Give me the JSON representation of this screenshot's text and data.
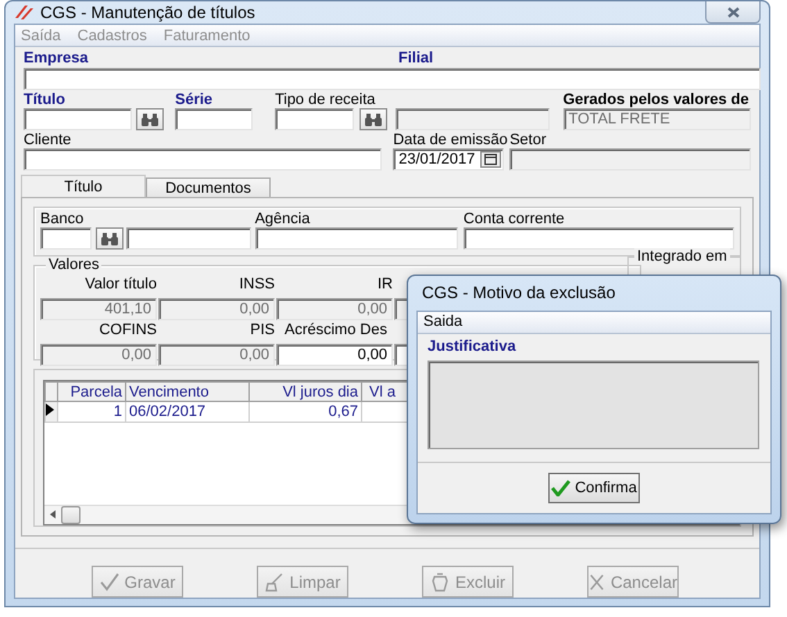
{
  "window": {
    "title": "CGS - Manutenção de títulos"
  },
  "menu": [
    {
      "label": "Saída",
      "disabled": true
    },
    {
      "label": "Cadastros",
      "disabled": true
    },
    {
      "label": "Faturamento",
      "disabled": true
    }
  ],
  "header": {
    "empresa_label": "Empresa",
    "filial_label": "Filial",
    "titulo_label": "Título",
    "serie_label": "Série",
    "tipo_receita_label": "Tipo de receita",
    "gerados_label": "Gerados pelos valores de",
    "gerados_value": "TOTAL FRETE",
    "cliente_label": "Cliente",
    "data_emissao_label": "Data de emissão",
    "data_emissao_value": "23/01/2017",
    "setor_label": "Setor"
  },
  "tabs": [
    {
      "label": "Título",
      "selected": true
    },
    {
      "label": "Documentos",
      "selected": false
    }
  ],
  "banco": {
    "banco_label": "Banco",
    "agencia_label": "Agência",
    "conta_label": "Conta corrente"
  },
  "valores": {
    "title": "Valores",
    "rows": [
      [
        {
          "label": "Valor título",
          "value": "401,10",
          "disabled": true
        },
        {
          "label": "INSS",
          "value": "0,00",
          "disabled": true
        },
        {
          "label": "IR",
          "value": "0,00",
          "disabled": true
        }
      ],
      [
        {
          "label": "COFINS",
          "value": "0,00",
          "disabled": true
        },
        {
          "label": "PIS",
          "value": "0,00",
          "disabled": true
        },
        {
          "label": "Acréscimo",
          "value": "0,00",
          "disabled": false
        }
      ]
    ],
    "cut_label": "Des"
  },
  "integrado": {
    "title": "Integrado em"
  },
  "grid": {
    "columns": [
      "Parcela",
      "Vencimento",
      "Vl juros dia",
      "Vl a"
    ],
    "rows": [
      {
        "cells": [
          "1",
          "06/02/2017",
          "0,67"
        ],
        "selected": true
      }
    ]
  },
  "buttons": [
    {
      "label": "Gravar",
      "kind": "save",
      "disabled": true
    },
    {
      "label": "Limpar",
      "kind": "clear",
      "disabled": true
    },
    {
      "label": "Excluir",
      "kind": "delete",
      "disabled": true
    },
    {
      "label": "Cancelar",
      "kind": "cancel",
      "disabled": true
    }
  ],
  "dialog": {
    "title": "CGS - Motivo da exclusão",
    "menu": [
      {
        "label": "Saida",
        "disabled": false
      }
    ],
    "label": "Justificativa",
    "button": "Confirma"
  }
}
